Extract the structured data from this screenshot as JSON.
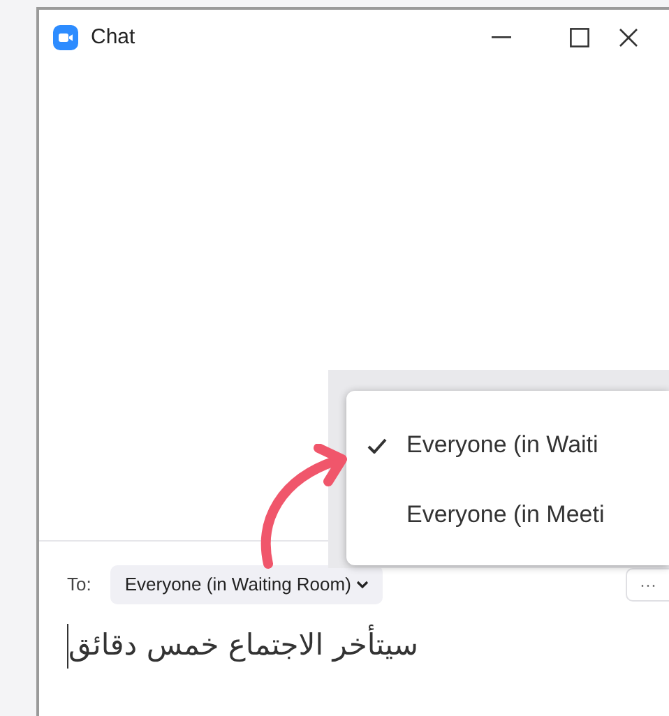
{
  "window": {
    "title": "Chat"
  },
  "recipient_menu": {
    "items": [
      {
        "label": "Everyone (in Waiti",
        "selected": true
      },
      {
        "label": "Everyone (in Meeti",
        "selected": false
      }
    ]
  },
  "composer": {
    "to_label": "To:",
    "recipient": "Everyone (in Waiting Room)",
    "more": "···",
    "message": "سيتأخر الاجتماع خمس دقائق"
  }
}
